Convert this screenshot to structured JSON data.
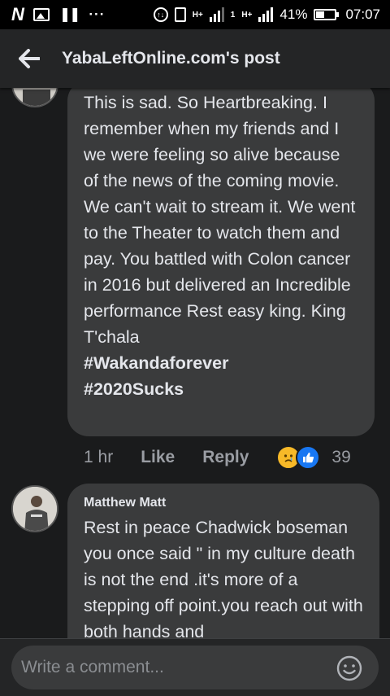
{
  "status_bar": {
    "battery": "41%",
    "time": "07:07",
    "net1": "H+",
    "net2": "1",
    "net3": "H+"
  },
  "header": {
    "title": "YabaLeftOnline.com's post",
    "back_icon": "arrow-left-icon"
  },
  "comments": [
    {
      "text": "This is sad. So Heartbreaking. I remember when my friends and I we were feeling so alive because of the news of the coming movie. We can't wait to stream it. We went to the Theater to watch them and pay. You battled with Colon cancer in 2016 but delivered an Incredible performance Rest easy king. King T'chala",
      "hashtags": [
        "#Wakandaforever",
        "#2020Sucks"
      ],
      "time": "1 hr",
      "like_label": "Like",
      "reply_label": "Reply",
      "reactions": [
        "sad",
        "like"
      ],
      "reaction_count": "39"
    },
    {
      "author": "Matthew Matt",
      "text": "Rest in peace Chadwick boseman you once said  \" in my culture death is not the end .it's more of a stepping off point.you reach out with both hands and"
    }
  ],
  "composer": {
    "placeholder": "Write a comment...",
    "emoji_icon": "smiley-icon"
  },
  "colors": {
    "background": "#1a1b1c",
    "bubble": "#3a3b3c",
    "header": "#242526",
    "text": "#e4e6eb",
    "muted": "#9a9da3",
    "like_blue": "#1877f2",
    "sad_yellow": "#f7b928"
  }
}
